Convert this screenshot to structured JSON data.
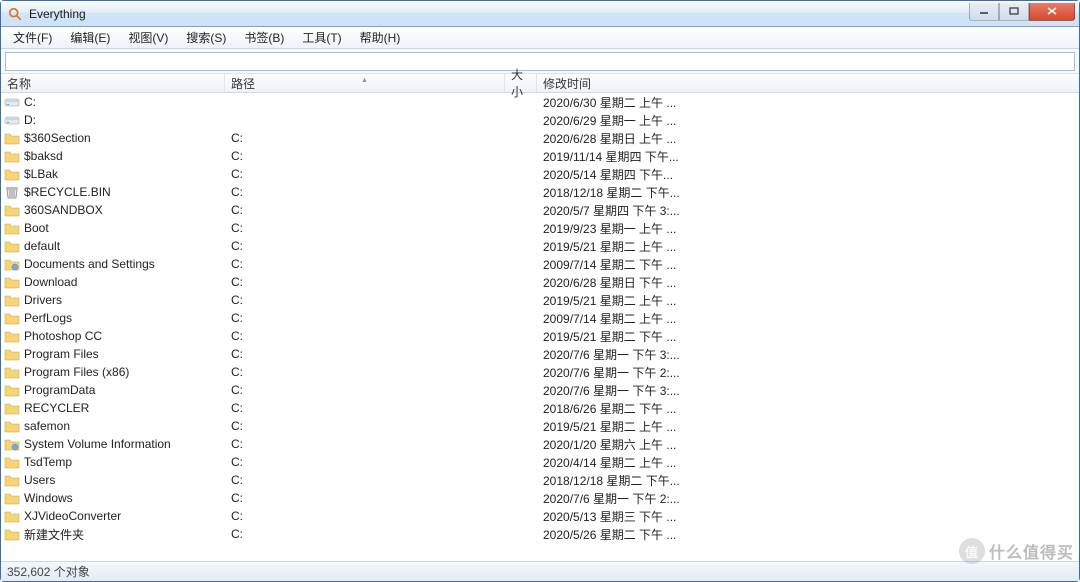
{
  "window": {
    "title": "Everything"
  },
  "menu": {
    "items": [
      "文件(F)",
      "编辑(E)",
      "视图(V)",
      "搜索(S)",
      "书签(B)",
      "工具(T)",
      "帮助(H)"
    ]
  },
  "search": {
    "value": "",
    "placeholder": ""
  },
  "columns": {
    "name": "名称",
    "path": "路径",
    "size": "大小",
    "date": "修改时间",
    "sorted": "path",
    "sort_dir": "asc"
  },
  "rows": [
    {
      "icon": "drive",
      "name": "C:",
      "path": "",
      "size": "",
      "date": "2020/6/30 星期二 上午 ..."
    },
    {
      "icon": "drive",
      "name": "D:",
      "path": "",
      "size": "",
      "date": "2020/6/29 星期一 上午 ..."
    },
    {
      "icon": "folder",
      "name": "$360Section",
      "path": "C:",
      "size": "",
      "date": "2020/6/28 星期日 上午 ..."
    },
    {
      "icon": "folder",
      "name": "$baksd",
      "path": "C:",
      "size": "",
      "date": "2019/11/14 星期四 下午..."
    },
    {
      "icon": "folder",
      "name": "$LBak",
      "path": "C:",
      "size": "",
      "date": "2020/5/14 星期四 下午..."
    },
    {
      "icon": "bin",
      "name": "$RECYCLE.BIN",
      "path": "C:",
      "size": "",
      "date": "2018/12/18 星期二 下午..."
    },
    {
      "icon": "folder",
      "name": "360SANDBOX",
      "path": "C:",
      "size": "",
      "date": "2020/5/7 星期四 下午 3:..."
    },
    {
      "icon": "folder",
      "name": "Boot",
      "path": "C:",
      "size": "",
      "date": "2019/9/23 星期一 上午 ..."
    },
    {
      "icon": "folder",
      "name": "default",
      "path": "C:",
      "size": "",
      "date": "2019/5/21 星期二 上午 ..."
    },
    {
      "icon": "sys",
      "name": "Documents and Settings",
      "path": "C:",
      "size": "",
      "date": "2009/7/14 星期二 下午 ..."
    },
    {
      "icon": "folder",
      "name": "Download",
      "path": "C:",
      "size": "",
      "date": "2020/6/28 星期日 下午 ..."
    },
    {
      "icon": "folder",
      "name": "Drivers",
      "path": "C:",
      "size": "",
      "date": "2019/5/21 星期二 上午 ..."
    },
    {
      "icon": "folder",
      "name": "PerfLogs",
      "path": "C:",
      "size": "",
      "date": "2009/7/14 星期二 上午 ..."
    },
    {
      "icon": "folder",
      "name": "Photoshop CC",
      "path": "C:",
      "size": "",
      "date": "2019/5/21 星期二 下午 ..."
    },
    {
      "icon": "folder",
      "name": "Program Files",
      "path": "C:",
      "size": "",
      "date": "2020/7/6 星期一 下午 3:..."
    },
    {
      "icon": "folder",
      "name": "Program Files (x86)",
      "path": "C:",
      "size": "",
      "date": "2020/7/6 星期一 下午 2:..."
    },
    {
      "icon": "folder",
      "name": "ProgramData",
      "path": "C:",
      "size": "",
      "date": "2020/7/6 星期一 下午 3:..."
    },
    {
      "icon": "folder",
      "name": "RECYCLER",
      "path": "C:",
      "size": "",
      "date": "2018/6/26 星期二 下午 ..."
    },
    {
      "icon": "folder",
      "name": "safemon",
      "path": "C:",
      "size": "",
      "date": "2019/5/21 星期二 上午 ..."
    },
    {
      "icon": "sys",
      "name": "System Volume Information",
      "path": "C:",
      "size": "",
      "date": "2020/1/20 星期六 上午 ..."
    },
    {
      "icon": "folder",
      "name": "TsdTemp",
      "path": "C:",
      "size": "",
      "date": "2020/4/14 星期二 上午 ..."
    },
    {
      "icon": "folder",
      "name": "Users",
      "path": "C:",
      "size": "",
      "date": "2018/12/18 星期二 下午..."
    },
    {
      "icon": "folder",
      "name": "Windows",
      "path": "C:",
      "size": "",
      "date": "2020/7/6 星期一 下午 2:..."
    },
    {
      "icon": "folder",
      "name": "XJVideoConverter",
      "path": "C:",
      "size": "",
      "date": "2020/5/13 星期三 下午 ..."
    },
    {
      "icon": "folder",
      "name": "新建文件夹",
      "path": "C:",
      "size": "",
      "date": "2020/5/26 星期二 下午 ..."
    }
  ],
  "status": {
    "text": "352,602 个对象"
  },
  "watermark": {
    "badge": "值",
    "text": "什么值得买"
  }
}
